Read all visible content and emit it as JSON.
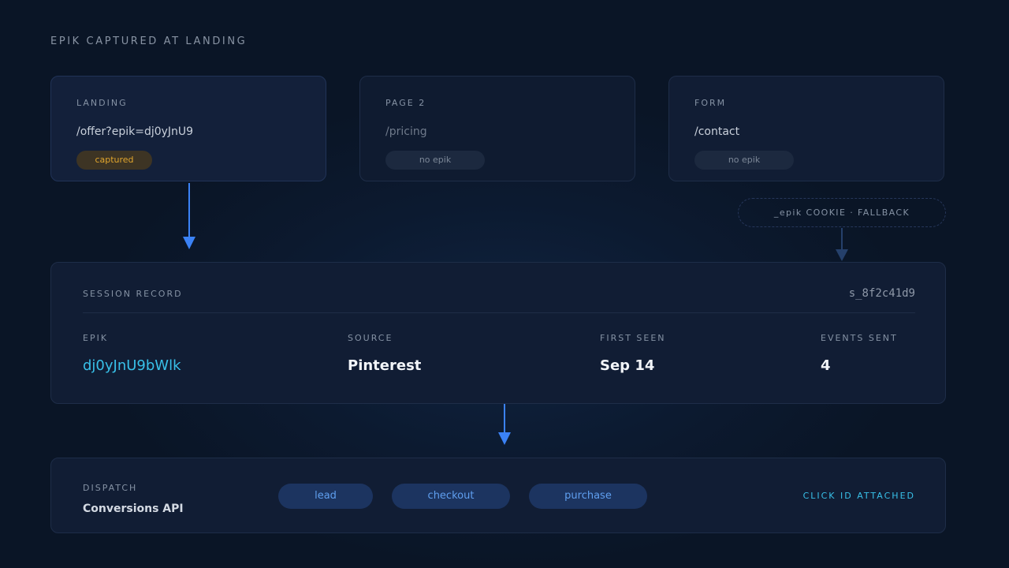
{
  "heading": "EPIK CAPTURED AT LANDING",
  "steps": [
    {
      "label": "LANDING",
      "url": "/offer?epik=dj0yJnU9",
      "status": "captured"
    },
    {
      "label": "PAGE 2",
      "url": "/pricing",
      "status": "no epik"
    },
    {
      "label": "FORM",
      "url": "/contact",
      "status": "no epik"
    }
  ],
  "cookie_fallback": "_epik COOKIE · FALLBACK",
  "session": {
    "title": "SESSION RECORD",
    "id": "s_8f2c41d9",
    "fields": [
      {
        "label": "EPIK",
        "value": "dj0yJnU9bWlk"
      },
      {
        "label": "SOURCE",
        "value": "Pinterest"
      },
      {
        "label": "FIRST SEEN",
        "value": "Sep 14"
      },
      {
        "label": "EVENTS SENT",
        "value": "4"
      }
    ]
  },
  "dispatch": {
    "label": "DISPATCH",
    "name": "Conversions API",
    "events": [
      "lead",
      "checkout",
      "purchase"
    ],
    "status": "CLICK ID ATTACHED"
  },
  "colors": {
    "background": "#0b1628",
    "card": "#111d34",
    "accent_blue": "#3b82f6",
    "accent_cyan": "#38c0e8",
    "captured_amber": "#e0a52e",
    "fallback_arrow": "#25406b"
  }
}
